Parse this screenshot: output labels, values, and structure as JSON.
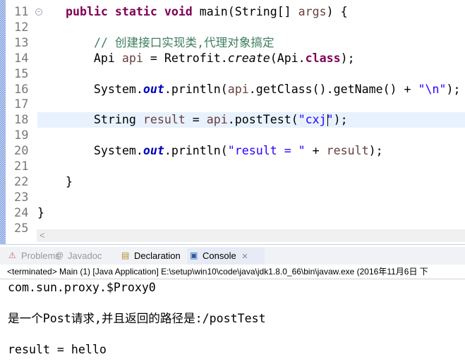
{
  "editor": {
    "lines": [
      {
        "n": "11",
        "fold": true,
        "segs": [
          [
            "    ",
            ""
          ],
          [
            "public static void ",
            "kw"
          ],
          [
            "main(String[] ",
            ""
          ],
          [
            "args",
            "var"
          ],
          [
            ") {",
            ""
          ]
        ]
      },
      {
        "n": "12",
        "segs": []
      },
      {
        "n": "13",
        "segs": [
          [
            "        ",
            ""
          ],
          [
            "// 创建接口实现类,代理对象搞定",
            "cm"
          ]
        ]
      },
      {
        "n": "14",
        "segs": [
          [
            "        Api ",
            ""
          ],
          [
            "api",
            "var"
          ],
          [
            " = Retrofit.",
            ""
          ],
          [
            "create",
            "it"
          ],
          [
            "(Api.",
            ""
          ],
          [
            "class",
            "kw"
          ],
          [
            ");",
            ""
          ]
        ]
      },
      {
        "n": "15",
        "segs": []
      },
      {
        "n": "16",
        "segs": [
          [
            "        System.",
            ""
          ],
          [
            "out",
            "fld"
          ],
          [
            ".println(",
            ""
          ],
          [
            "api",
            "var"
          ],
          [
            ".getClass().getName() + ",
            ""
          ],
          [
            "\"\\n\"",
            "st"
          ],
          [
            ");",
            ""
          ]
        ]
      },
      {
        "n": "17",
        "segs": []
      },
      {
        "n": "18",
        "current": true,
        "segs": [
          [
            "        String ",
            ""
          ],
          [
            "result",
            "var"
          ],
          [
            " = ",
            ""
          ],
          [
            "api",
            "var"
          ],
          [
            ".postTest(",
            ""
          ],
          [
            "\"cxj\"",
            "st"
          ],
          [
            ");",
            ""
          ]
        ]
      },
      {
        "n": "19",
        "segs": []
      },
      {
        "n": "20",
        "segs": [
          [
            "        System.",
            ""
          ],
          [
            "out",
            "fld"
          ],
          [
            ".println(",
            ""
          ],
          [
            "\"result = \"",
            "st"
          ],
          [
            " + ",
            ""
          ],
          [
            "result",
            "var"
          ],
          [
            ");",
            ""
          ]
        ]
      },
      {
        "n": "21",
        "segs": []
      },
      {
        "n": "22",
        "segs": [
          [
            "    }",
            ""
          ]
        ]
      },
      {
        "n": "23",
        "segs": []
      },
      {
        "n": "24",
        "segs": [
          [
            "}",
            ""
          ]
        ]
      },
      {
        "n": "25",
        "segs": []
      }
    ],
    "scroll_left": "<"
  },
  "panel": {
    "tabs": [
      {
        "label": "Problems",
        "icon": "problems-icon",
        "glyph": "⚠",
        "active": false
      },
      {
        "label": "Javadoc",
        "icon": "javadoc-icon",
        "glyph": "@",
        "active": false
      },
      {
        "label": "Declaration",
        "icon": "declaration-icon",
        "glyph": "▤",
        "active": false
      },
      {
        "label": "Console",
        "icon": "console-icon",
        "glyph": "▣",
        "active": true
      }
    ],
    "close": "✕",
    "status": "<terminated> Main (1) [Java Application] E:\\setup\\win10\\code\\java\\jdk1.8.0_66\\bin\\javaw.exe (2016年11月6日 下",
    "output": [
      "com.sun.proxy.$Proxy0",
      "",
      "是一个Post请求,并且返回的路径是:/postTest",
      "",
      "result = hello"
    ]
  }
}
